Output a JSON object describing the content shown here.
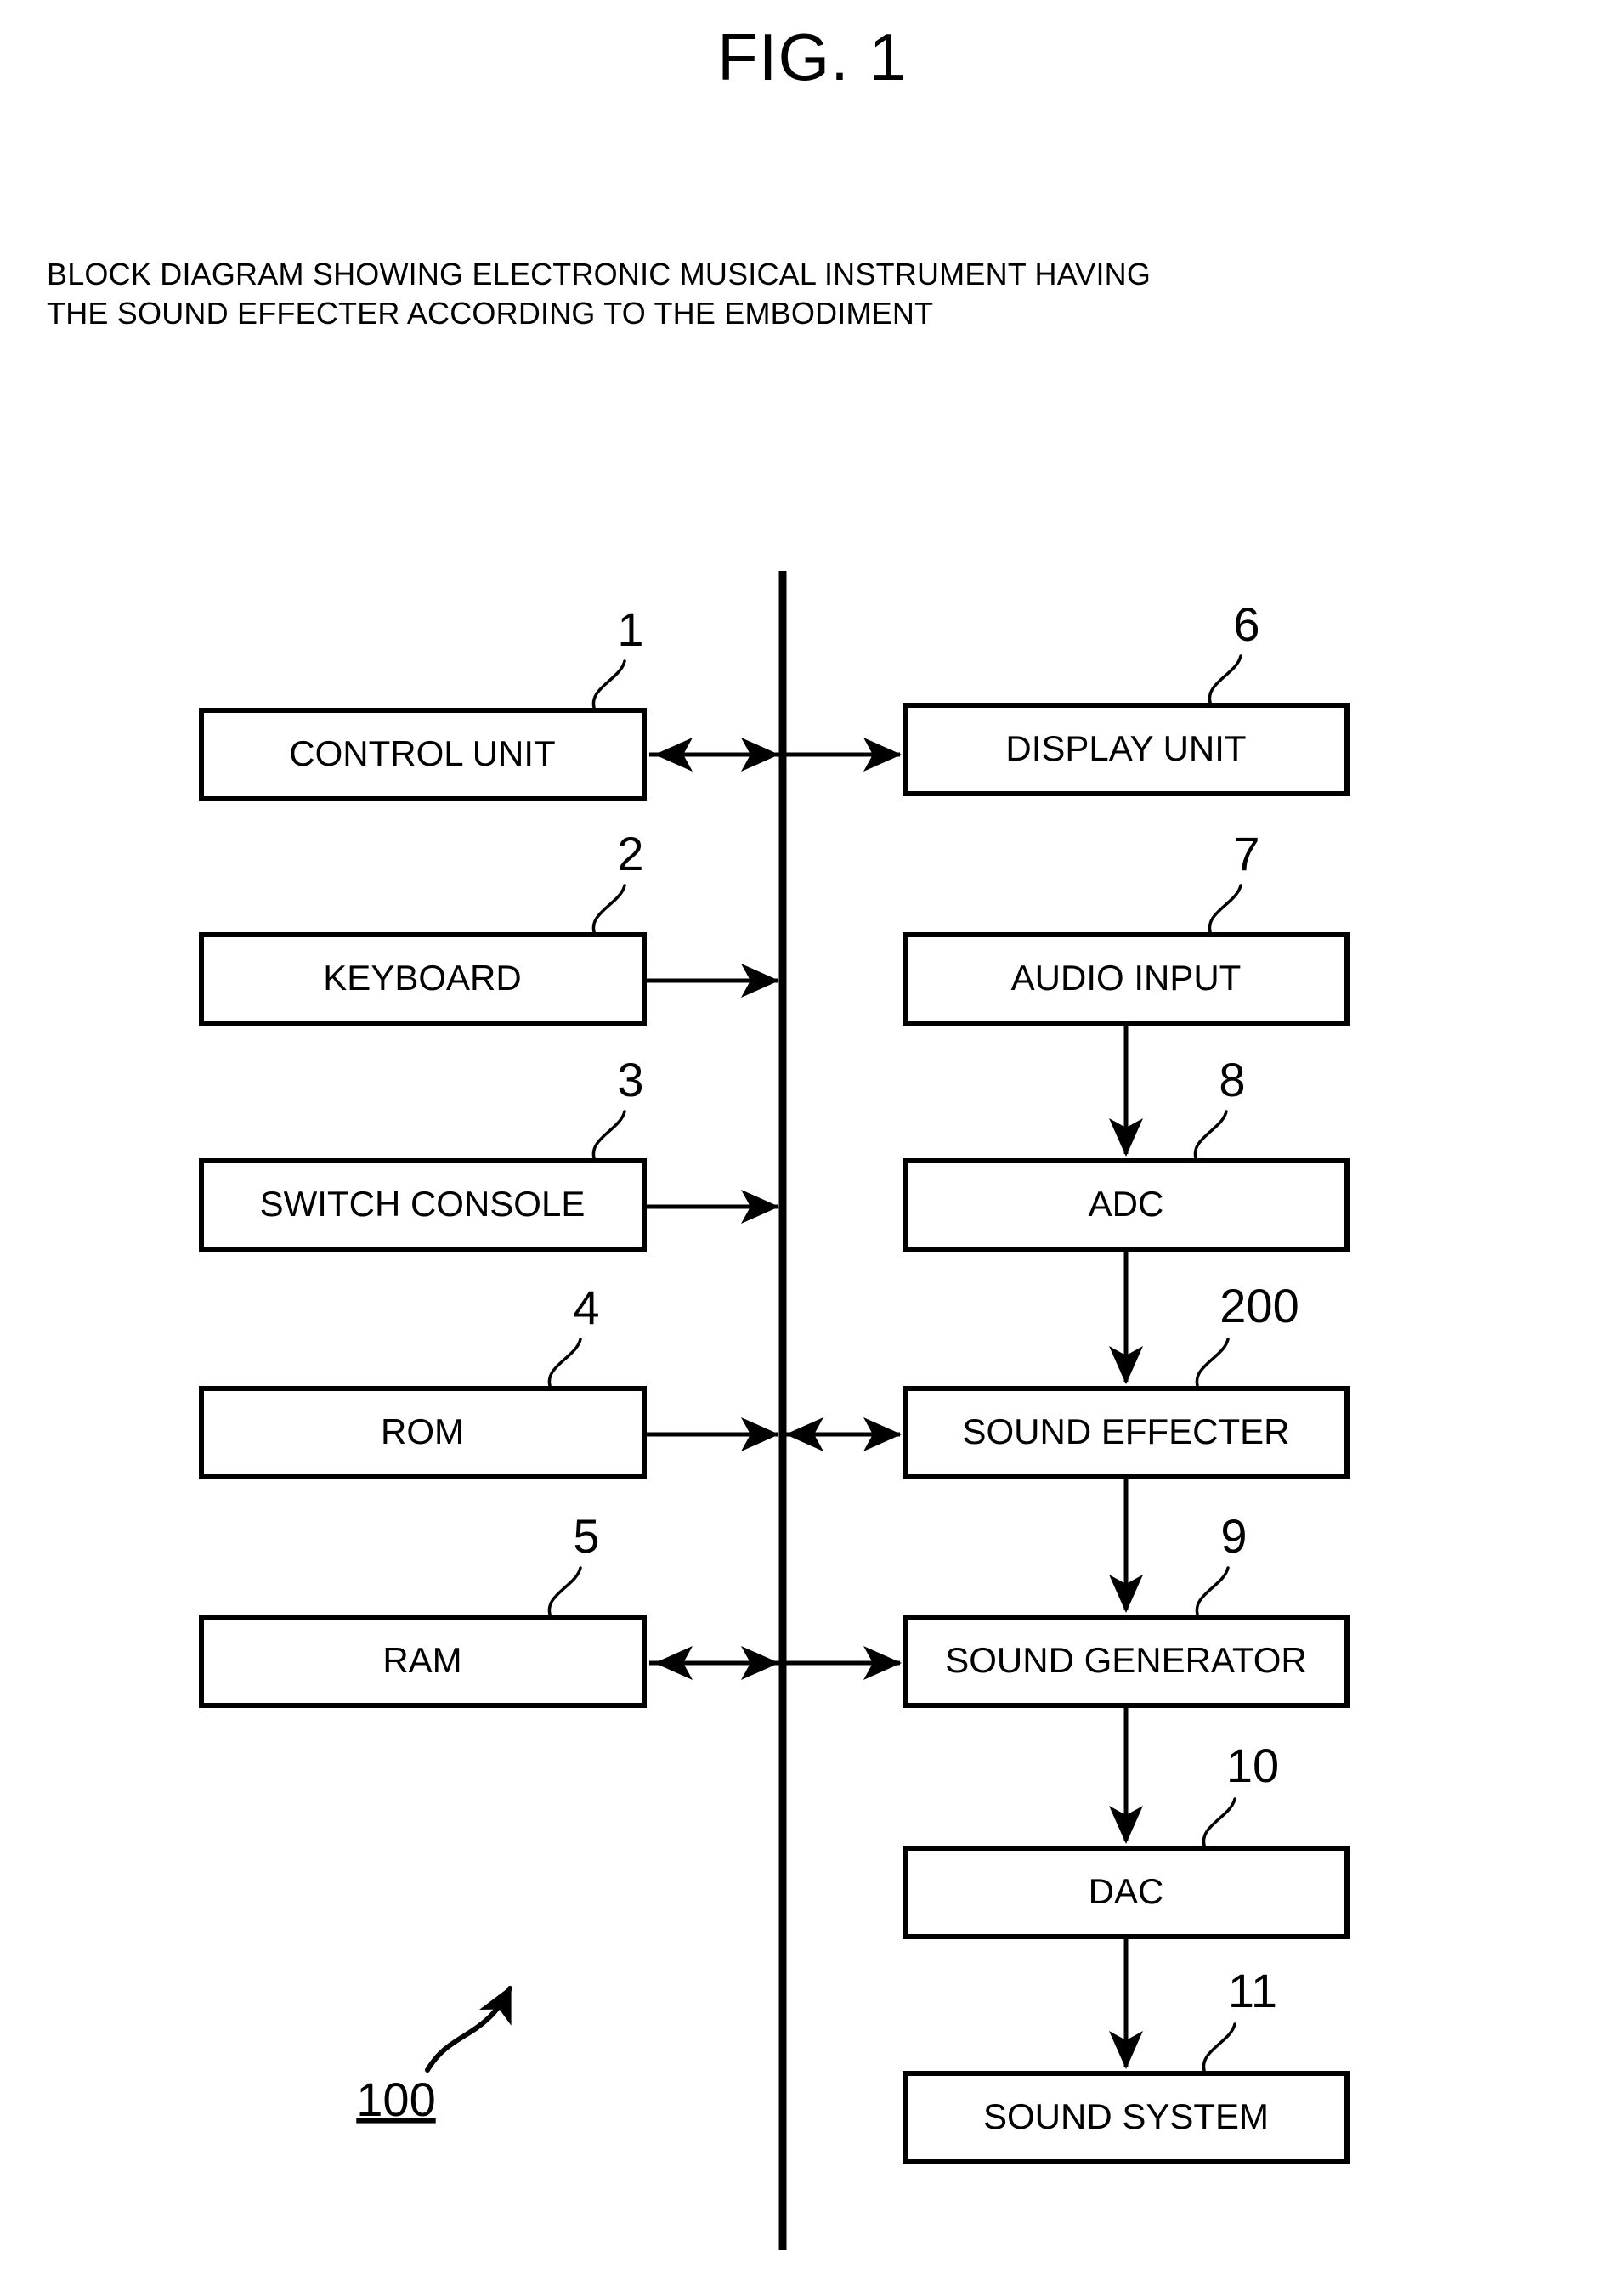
{
  "figure": {
    "title": "FIG. 1",
    "subtitle_line1": "BLOCK DIAGRAM SHOWING ELECTRONIC MUSICAL INSTRUMENT HAVING",
    "subtitle_line2": "THE SOUND EFFECTER ACCORDING TO THE EMBODIMENT",
    "system_ref": "100"
  },
  "left_blocks": [
    {
      "label": "CONTROL UNIT",
      "ref": "1"
    },
    {
      "label": "KEYBOARD",
      "ref": "2"
    },
    {
      "label": "SWITCH CONSOLE",
      "ref": "3"
    },
    {
      "label": "ROM",
      "ref": "4"
    },
    {
      "label": "RAM",
      "ref": "5"
    }
  ],
  "right_blocks": [
    {
      "label": "DISPLAY UNIT",
      "ref": "6"
    },
    {
      "label": "AUDIO INPUT",
      "ref": "7"
    },
    {
      "label": "ADC",
      "ref": "8"
    },
    {
      "label": "SOUND EFFECTER",
      "ref": "200"
    },
    {
      "label": "SOUND GENERATOR",
      "ref": "9"
    },
    {
      "label": "DAC",
      "ref": "10"
    },
    {
      "label": "SOUND SYSTEM",
      "ref": "11"
    }
  ],
  "colors": {
    "line": "#000000",
    "background": "#ffffff",
    "text": "#000000"
  }
}
